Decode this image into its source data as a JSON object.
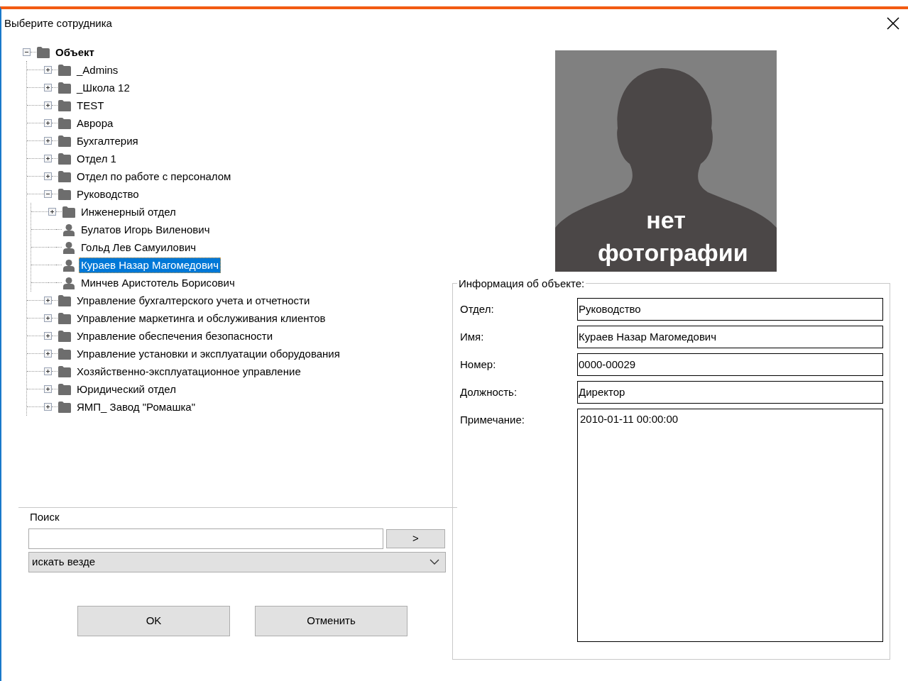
{
  "window": {
    "title": "Выберите сотрудника"
  },
  "tree": [
    {
      "label": "Объект",
      "kind": "folder",
      "expanded": true,
      "selected": false,
      "children": [
        {
          "label": "_Admins",
          "kind": "folder",
          "expanded": false,
          "selected": false
        },
        {
          "label": "_Школа 12",
          "kind": "folder",
          "expanded": false,
          "selected": false
        },
        {
          "label": "TEST",
          "kind": "folder",
          "expanded": false,
          "selected": false
        },
        {
          "label": "Аврора",
          "kind": "folder",
          "expanded": false,
          "selected": false
        },
        {
          "label": "Бухгалтерия",
          "kind": "folder",
          "expanded": false,
          "selected": false
        },
        {
          "label": "Отдел 1",
          "kind": "folder",
          "expanded": false,
          "selected": false
        },
        {
          "label": "Отдел по работе с персоналом",
          "kind": "folder",
          "expanded": false,
          "selected": false
        },
        {
          "label": "Руководство",
          "kind": "folder",
          "expanded": true,
          "selected": false,
          "children": [
            {
              "label": "Инженерный отдел",
              "kind": "folder",
              "expanded": false,
              "selected": false
            },
            {
              "label": "Булатов Игорь Виленович",
              "kind": "person",
              "selected": false
            },
            {
              "label": "Гольд Лев Самуилович",
              "kind": "person",
              "selected": false
            },
            {
              "label": "Кураев Назар Магомедович",
              "kind": "person",
              "selected": true
            },
            {
              "label": "Минчев Аристотель Борисович",
              "kind": "person",
              "selected": false
            }
          ]
        },
        {
          "label": "Управление бухгалтерского учета и отчетности",
          "kind": "folder",
          "expanded": false,
          "selected": false
        },
        {
          "label": "Управление маркетинга и обслуживания клиентов",
          "kind": "folder",
          "expanded": false,
          "selected": false
        },
        {
          "label": "Управление обеспечения безопасности",
          "kind": "folder",
          "expanded": false,
          "selected": false
        },
        {
          "label": "Управление установки и эксплуатации оборудования",
          "kind": "folder",
          "expanded": false,
          "selected": false
        },
        {
          "label": "Хозяйственно-эксплуатационное управление",
          "kind": "folder",
          "expanded": false,
          "selected": false
        },
        {
          "label": "Юридический отдел",
          "kind": "folder",
          "expanded": false,
          "selected": false
        },
        {
          "label": "ЯМП_ Завод \"Ромашка\"",
          "kind": "folder",
          "expanded": false,
          "selected": false
        }
      ]
    }
  ],
  "search": {
    "label": "Поиск",
    "go_button": ">",
    "scope": "искать везде"
  },
  "buttons": [
    "OK",
    "Отменить"
  ],
  "photo": {
    "caption": "нет фотографии"
  },
  "info": {
    "title": "Информация об объекте:",
    "fields": [
      {
        "label": "Отдел:",
        "value": "Руководство",
        "kind": "line"
      },
      {
        "label": "Имя:",
        "value": "Кураев Назар Магомедович",
        "kind": "line"
      },
      {
        "label": "Номер:",
        "value": "0000-00029",
        "kind": "line"
      },
      {
        "label": "Должность:",
        "value": "Директор",
        "kind": "line"
      },
      {
        "label": "Примечание:",
        "value": "2010-01-11 00:00:00",
        "kind": "multiline"
      }
    ]
  }
}
